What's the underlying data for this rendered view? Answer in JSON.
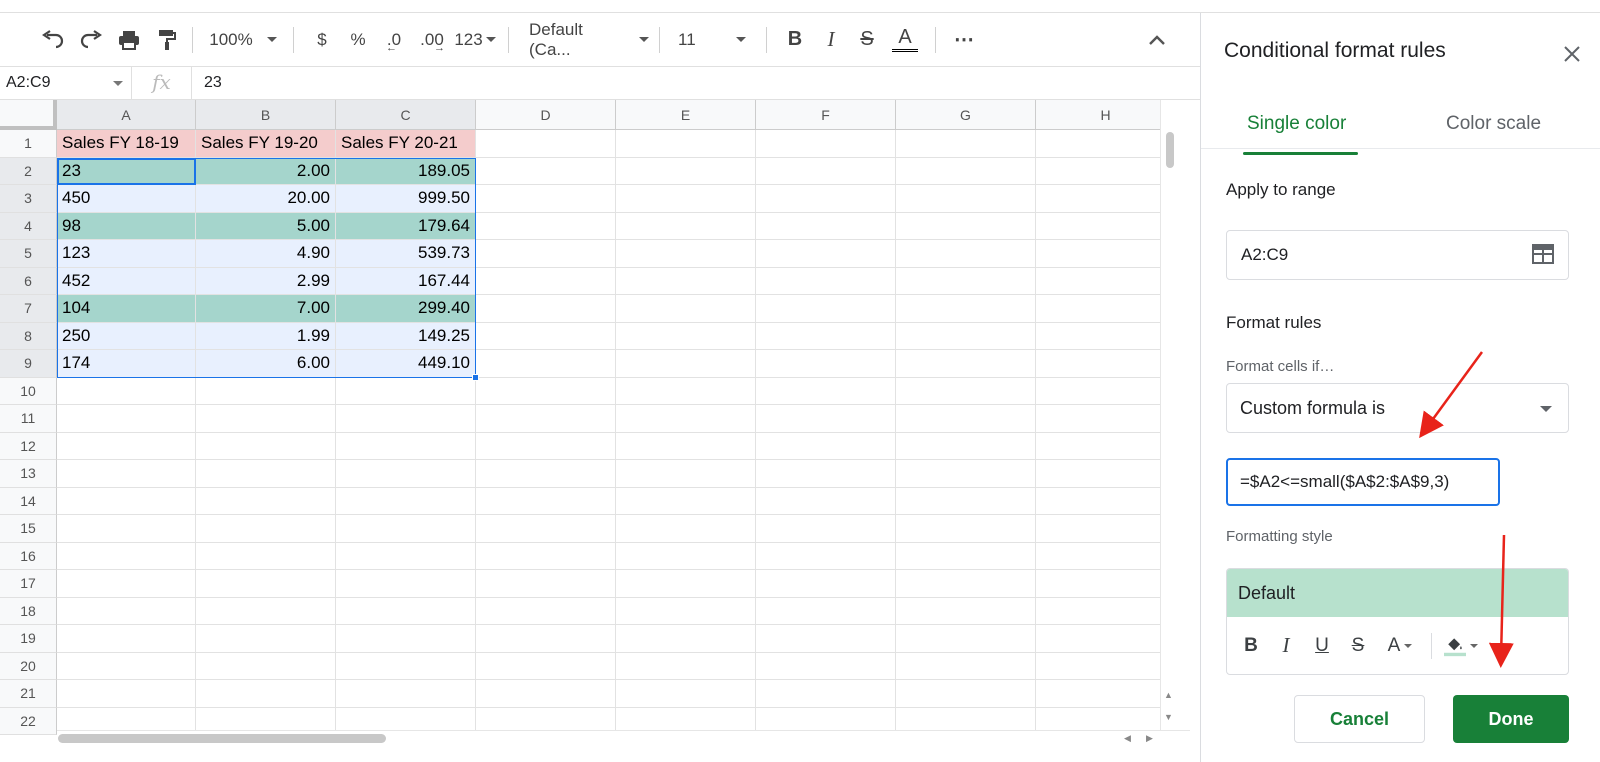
{
  "toolbar": {
    "zoom": "100%",
    "currency": "$",
    "percent": "%",
    "decrease_decimal": ".0",
    "increase_decimal": ".00",
    "more_formats": "123",
    "font_family": "Default (Ca...",
    "font_size": "11",
    "bold": "B",
    "italic": "I",
    "strikethrough": "S",
    "text_color": "A",
    "more": "⋯"
  },
  "formula_bar": {
    "name_box": "A2:C9",
    "fx": "fx",
    "value": "23"
  },
  "sheet": {
    "columns": [
      "A",
      "B",
      "C",
      "D",
      "E",
      "F",
      "G",
      "H"
    ],
    "rows": [
      "1",
      "2",
      "3",
      "4",
      "5",
      "6",
      "7",
      "8",
      "9",
      "10",
      "11",
      "12",
      "13",
      "14",
      "15",
      "16",
      "17",
      "18",
      "19",
      "20",
      "21",
      "22"
    ],
    "header": [
      "Sales FY 18-19",
      "Sales  FY 19-20",
      "Sales  FY 20-21"
    ],
    "data": [
      [
        "23",
        "2.00",
        "189.05"
      ],
      [
        "450",
        "20.00",
        "999.50"
      ],
      [
        "98",
        "5.00",
        "179.64"
      ],
      [
        "123",
        "4.90",
        "539.73"
      ],
      [
        "452",
        "2.99",
        "167.44"
      ],
      [
        "104",
        "7.00",
        "299.40"
      ],
      [
        "250",
        "1.99",
        "149.25"
      ],
      [
        "174",
        "6.00",
        "449.10"
      ]
    ],
    "highlighted_rows": [
      1,
      3,
      6
    ],
    "colors": {
      "header_fill": "#f4cccc",
      "highlight_fill": "#a5d5cc",
      "selection_fill": "#e8f0fe",
      "selection_border": "#1a73e8"
    }
  },
  "panel": {
    "title": "Conditional format rules",
    "tabs": [
      "Single color",
      "Color scale"
    ],
    "apply_to_range_label": "Apply to range",
    "range_value": "A2:C9",
    "format_rules_label": "Format rules",
    "format_cells_if_label": "Format cells if…",
    "condition": "Custom formula is",
    "formula": "=$A2<=small($A$2:$A$9,3)",
    "formatting_style_label": "Formatting style",
    "style_preview": "Default",
    "style_buttons": [
      "B",
      "I",
      "U",
      "S",
      "A"
    ],
    "cancel": "Cancel",
    "done": "Done",
    "accent": "#188038"
  }
}
